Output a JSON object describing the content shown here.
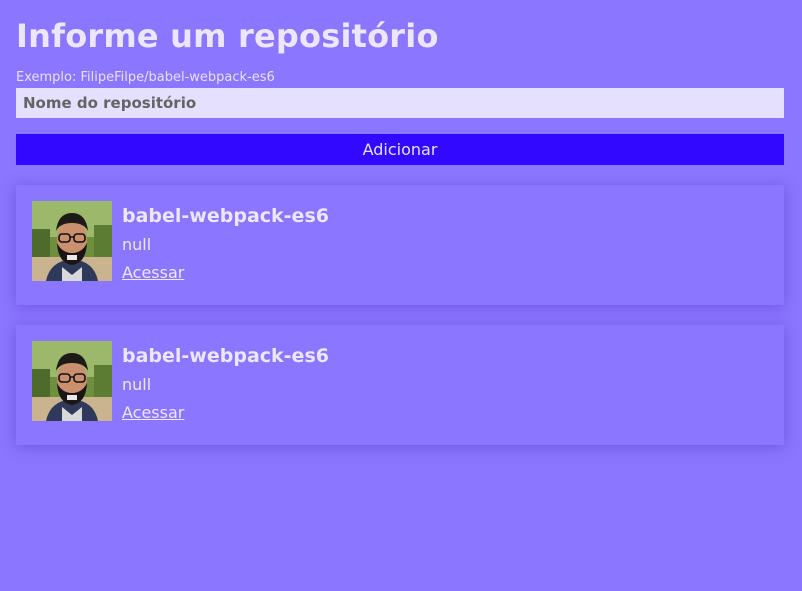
{
  "header": {
    "title": "Informe um repositório",
    "hint": "Exemplo: FilipeFilpe/babel-webpack-es6"
  },
  "form": {
    "input_placeholder": "Nome do repositório",
    "input_value": "",
    "add_button_label": "Adicionar"
  },
  "repositories": [
    {
      "name": "babel-webpack-es6",
      "description": "null",
      "link_label": "Acessar",
      "avatar_icon": "user-avatar-photo"
    },
    {
      "name": "babel-webpack-es6",
      "description": "null",
      "link_label": "Acessar",
      "avatar_icon": "user-avatar-photo"
    }
  ],
  "colors": {
    "background": "#8B76FF",
    "button": "#3308FF",
    "input_background": "#E6E0FF",
    "text": "#ECE6FF"
  }
}
